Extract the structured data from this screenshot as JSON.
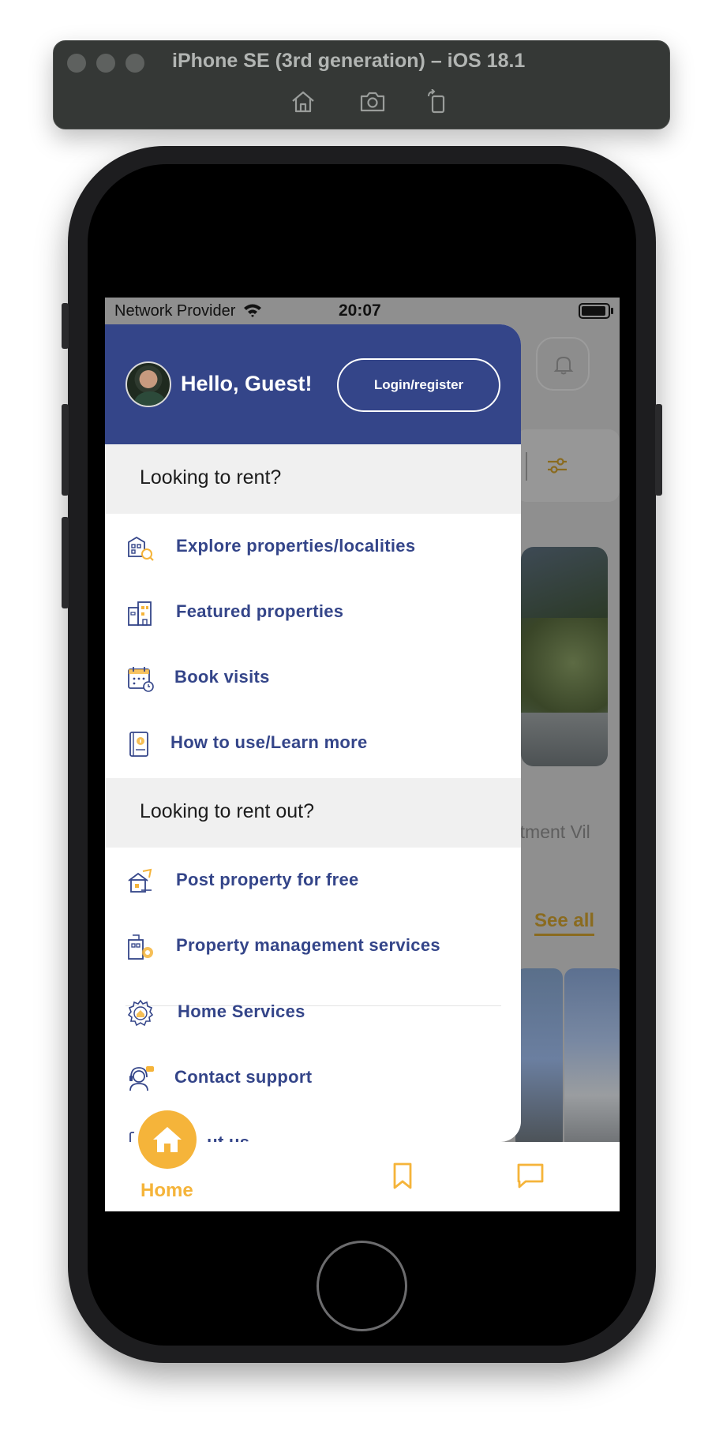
{
  "simulator": {
    "title": "iPhone SE (3rd generation) – iOS 18.1",
    "icons": [
      "home-icon",
      "screenshot-icon",
      "rotate-icon"
    ]
  },
  "status_bar": {
    "carrier": "Network Provider",
    "time": "20:07"
  },
  "background": {
    "categories_fragment": "rtment   Vil",
    "see_all": "See all"
  },
  "drawer": {
    "greeting": "Hello, Guest!",
    "login_button": "Login/register",
    "sections": [
      {
        "title": "Looking to rent?",
        "items": [
          {
            "label": "Explore properties/localities",
            "icon": "property-search-icon"
          },
          {
            "label": "Featured properties",
            "icon": "buildings-icon"
          },
          {
            "label": "Book visits",
            "icon": "calendar-icon"
          },
          {
            "label": "How to use/Learn more",
            "icon": "book-icon"
          }
        ]
      },
      {
        "title": "Looking to rent out?",
        "items": [
          {
            "label": "Post property for free",
            "icon": "post-property-icon"
          },
          {
            "label": "Property management services",
            "icon": "property-management-icon"
          },
          {
            "label": "Home Services",
            "icon": "home-services-icon"
          },
          {
            "label": "Contact support",
            "icon": "support-agent-icon"
          },
          {
            "label": "...ut us",
            "icon": "info-icon"
          }
        ]
      }
    ]
  },
  "bottom_nav": {
    "items": [
      {
        "label": "Home",
        "icon": "home-icon",
        "active": true
      },
      {
        "label": "",
        "icon": "bookmark-icon",
        "active": false
      },
      {
        "label": "",
        "icon": "chat-icon",
        "active": false
      },
      {
        "label": "",
        "icon": "profile-icon",
        "active": false
      }
    ]
  },
  "colors": {
    "primary": "#344589",
    "accent": "#f5b43a",
    "section_bg": "#f0f0f0"
  }
}
